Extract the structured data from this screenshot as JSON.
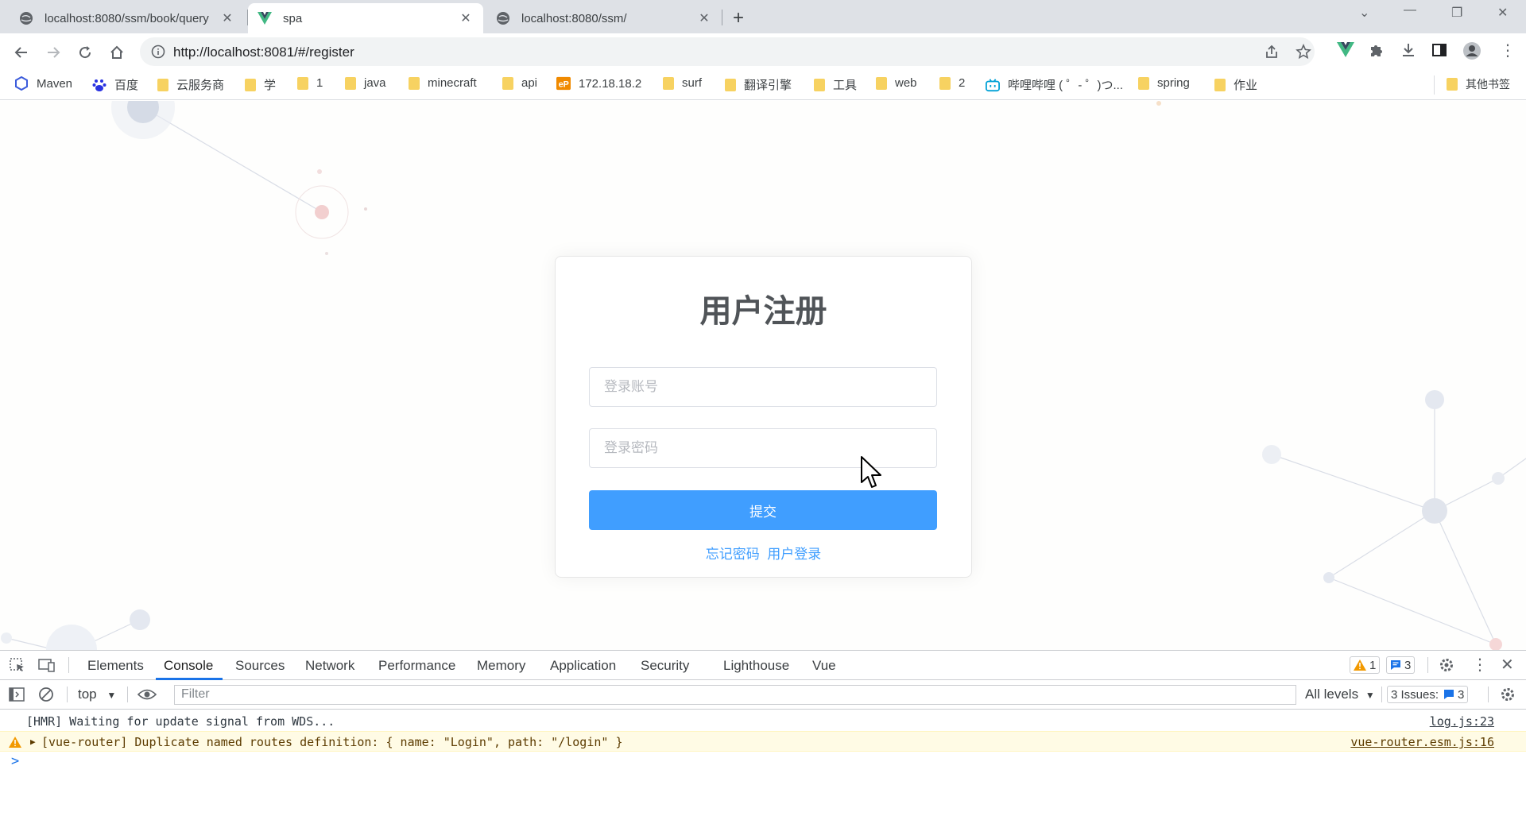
{
  "browser": {
    "tabs": [
      {
        "title": "localhost:8080/ssm/book/query",
        "favicon": "globe-icon",
        "active": false
      },
      {
        "title": "spa",
        "favicon": "vue-icon",
        "active": true
      },
      {
        "title": "localhost:8080/ssm/",
        "favicon": "globe-icon",
        "active": false
      }
    ],
    "url": "http://localhost:8081/#/register",
    "bookmarks": [
      {
        "label": "Maven",
        "icon": "maven-icon"
      },
      {
        "label": "百度",
        "icon": "baidu-icon"
      },
      {
        "label": "云服务商",
        "icon": "folder-icon"
      },
      {
        "label": "学",
        "icon": "folder-icon"
      },
      {
        "label": "1",
        "icon": "folder-icon"
      },
      {
        "label": "java",
        "icon": "folder-icon"
      },
      {
        "label": "minecraft",
        "icon": "folder-icon"
      },
      {
        "label": "api",
        "icon": "folder-icon"
      },
      {
        "label": "172.18.18.2",
        "icon": "ep-icon"
      },
      {
        "label": "surf",
        "icon": "folder-icon"
      },
      {
        "label": "翻译引擎",
        "icon": "folder-icon"
      },
      {
        "label": "工具",
        "icon": "folder-icon"
      },
      {
        "label": "web",
        "icon": "folder-icon"
      },
      {
        "label": "2",
        "icon": "folder-icon"
      },
      {
        "label": "哔哩哔哩 ( ゜- ゜)つ...",
        "icon": "bilibili-icon"
      },
      {
        "label": "spring",
        "icon": "folder-icon"
      },
      {
        "label": "作业",
        "icon": "folder-icon"
      }
    ],
    "other_bookmarks": "其他书签"
  },
  "form": {
    "title": "用户注册",
    "account_placeholder": "登录账号",
    "password_placeholder": "登录密码",
    "submit_label": "提交",
    "forgot_link": "忘记密码",
    "login_link": "用户登录"
  },
  "devtools": {
    "tabs": [
      "Elements",
      "Console",
      "Sources",
      "Network",
      "Performance",
      "Memory",
      "Application",
      "Security",
      "Lighthouse",
      "Vue"
    ],
    "active_tab": "Console",
    "warning_count": "1",
    "message_count": "3",
    "context": "top",
    "filter_placeholder": "Filter",
    "levels": "All levels",
    "issues_label": "3 Issues:",
    "issues_count": "3",
    "console": [
      {
        "level": "info",
        "message": "[HMR] Waiting for update signal from WDS...",
        "source": "log.js:23"
      },
      {
        "level": "warning",
        "message": "[vue-router] Duplicate named routes definition: { name: \"Login\", path: \"/login\" }",
        "source": "vue-router.esm.js:16"
      }
    ],
    "prompt": ">"
  },
  "colors": {
    "primary": "#409eff",
    "warning": "#f29900",
    "devtools_accent": "#1a73e8",
    "vue": "#41b883"
  }
}
